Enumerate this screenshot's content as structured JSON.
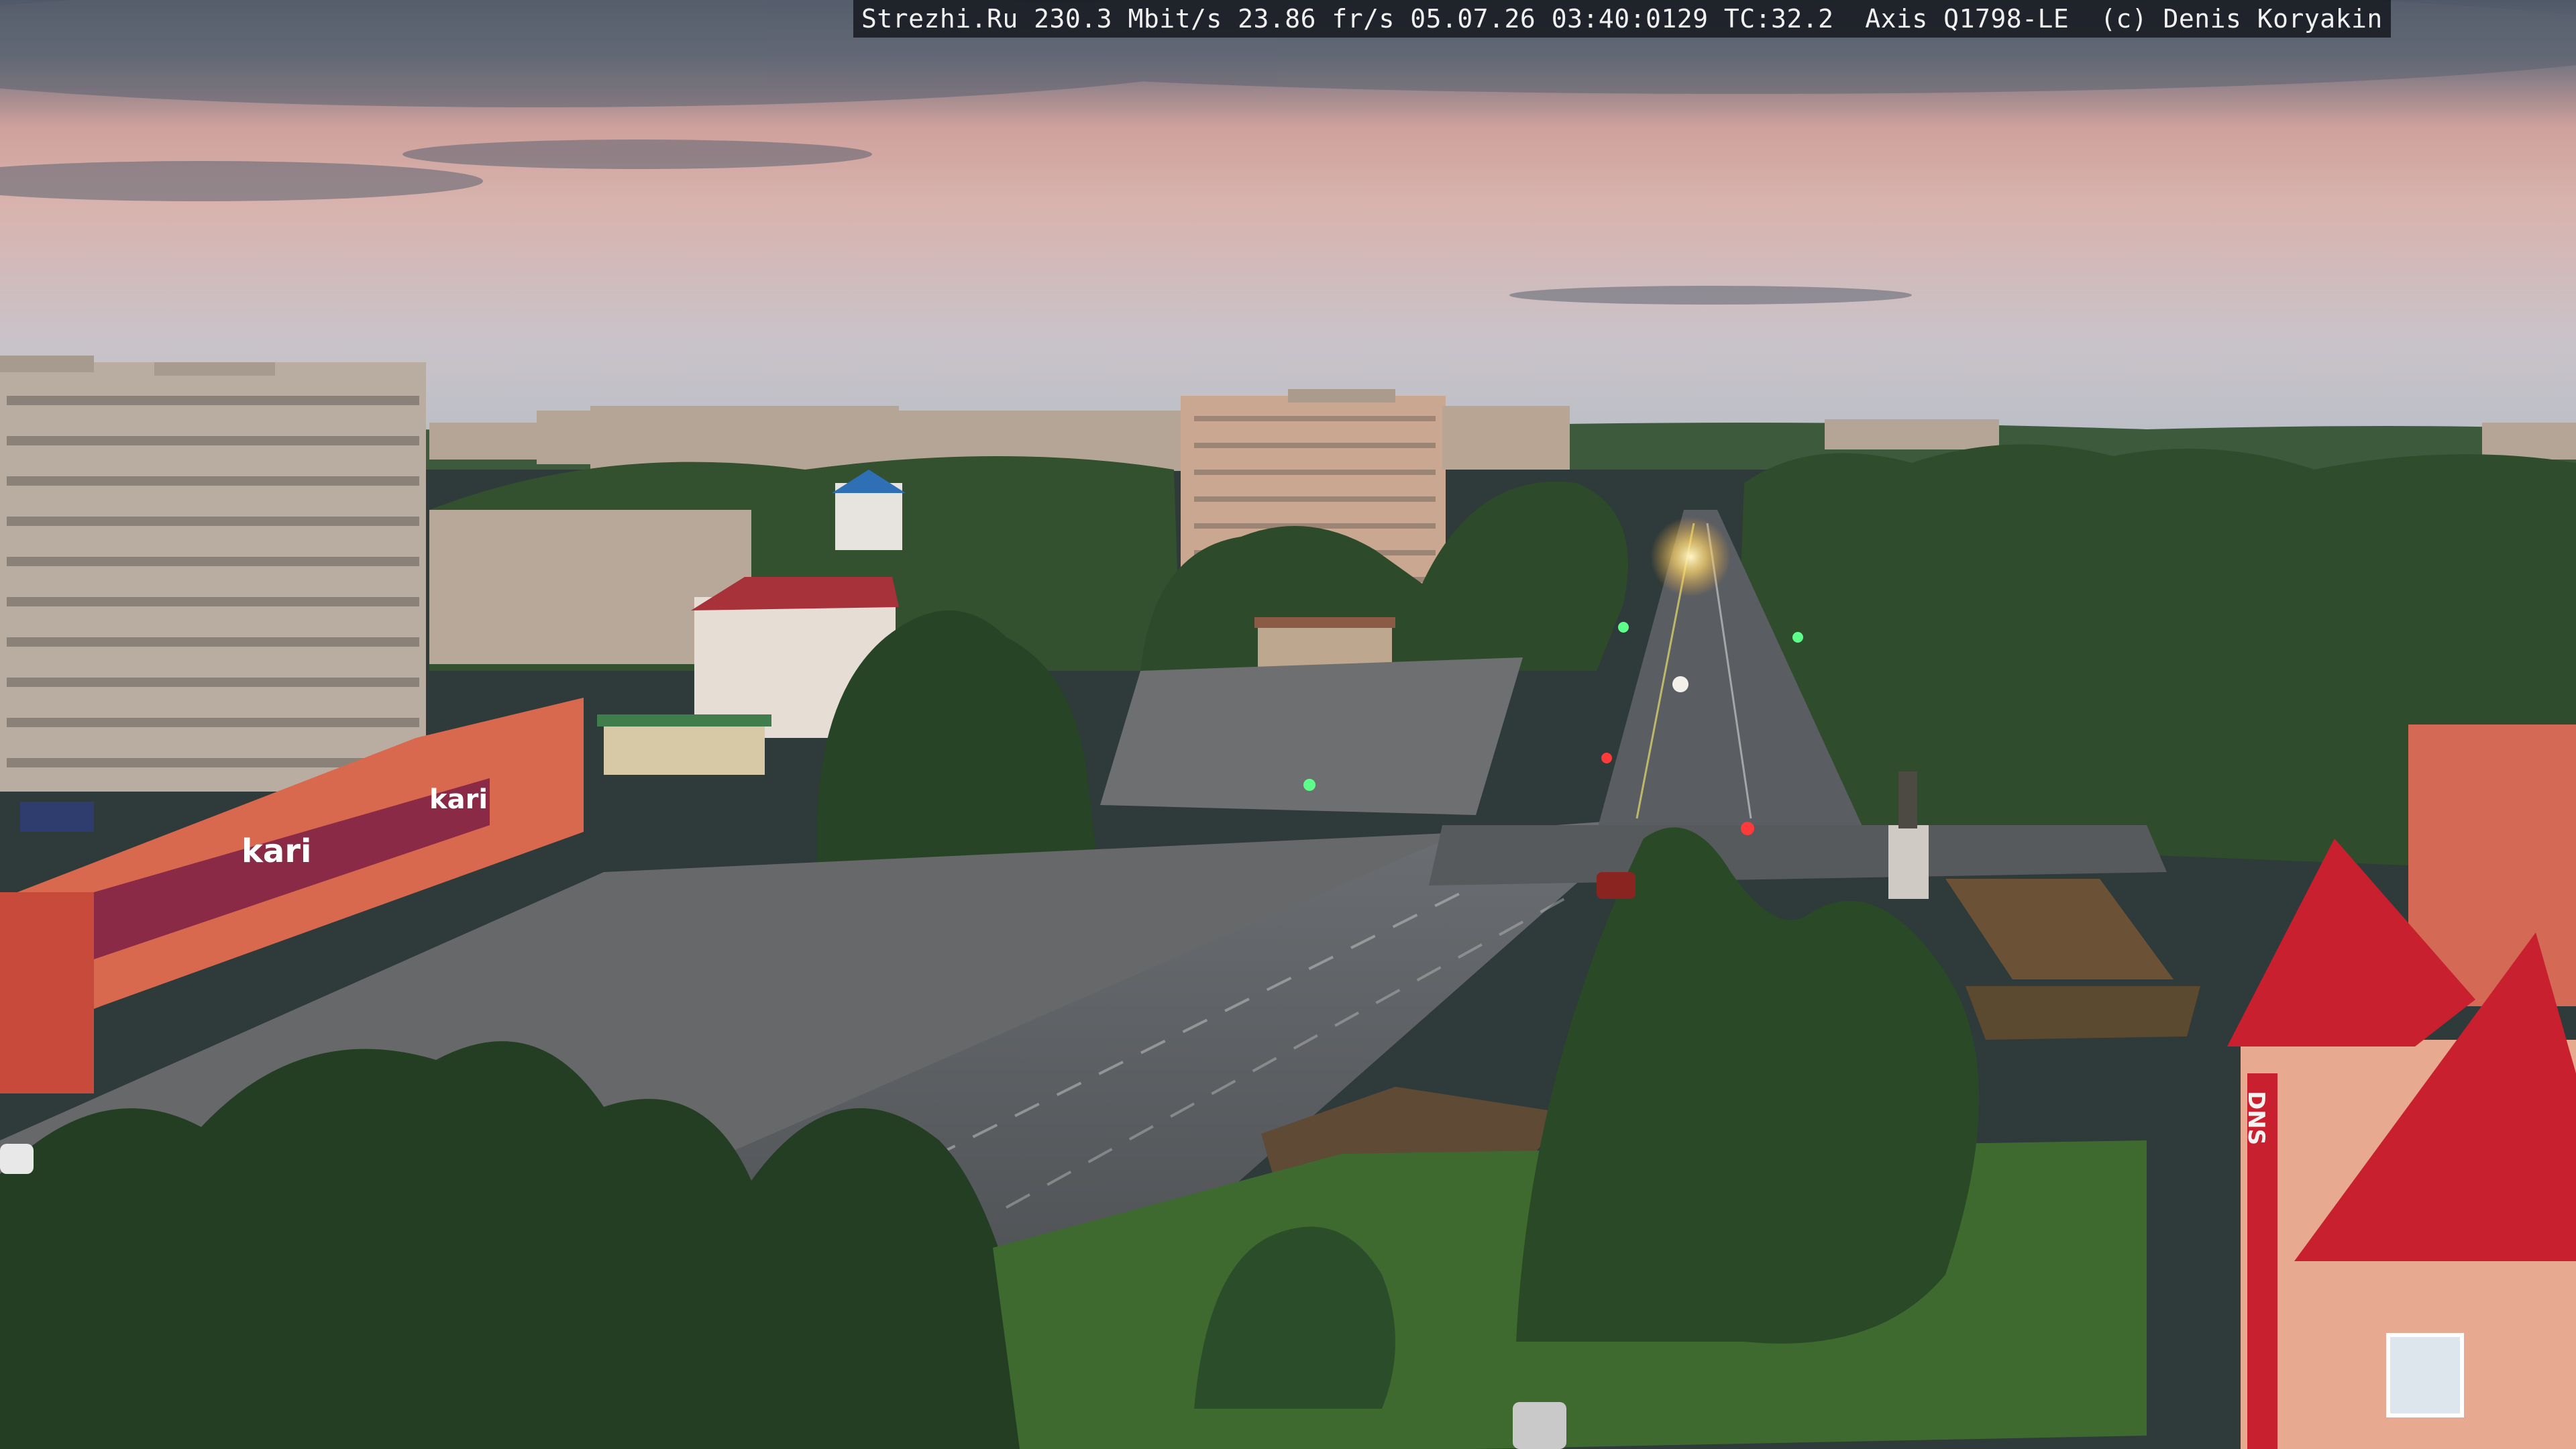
{
  "overlay": {
    "site": "Strezhi.Ru",
    "bitrate": "230.3 Mbit/s",
    "framerate": "23.86 fr/s",
    "date": "05.07.26",
    "time": "03:40:0129",
    "tc": "TC:32.2",
    "camera": "Axis Q1798-LE",
    "copyright": "(c) Denis Koryakin"
  },
  "signs": {
    "kari_top": "kari",
    "kari_main": "kari",
    "dns": "DNS"
  },
  "colors": {
    "sky_top": "#5d6676",
    "sky_pink": "#d9a8a2",
    "sky_horizon": "#c9c4c8",
    "trees": "#2d4a2a",
    "road": "#5a5d60",
    "brick_orange": "#d9694e",
    "red_roof": "#c8202e",
    "panel_building": "#b9a89a"
  }
}
